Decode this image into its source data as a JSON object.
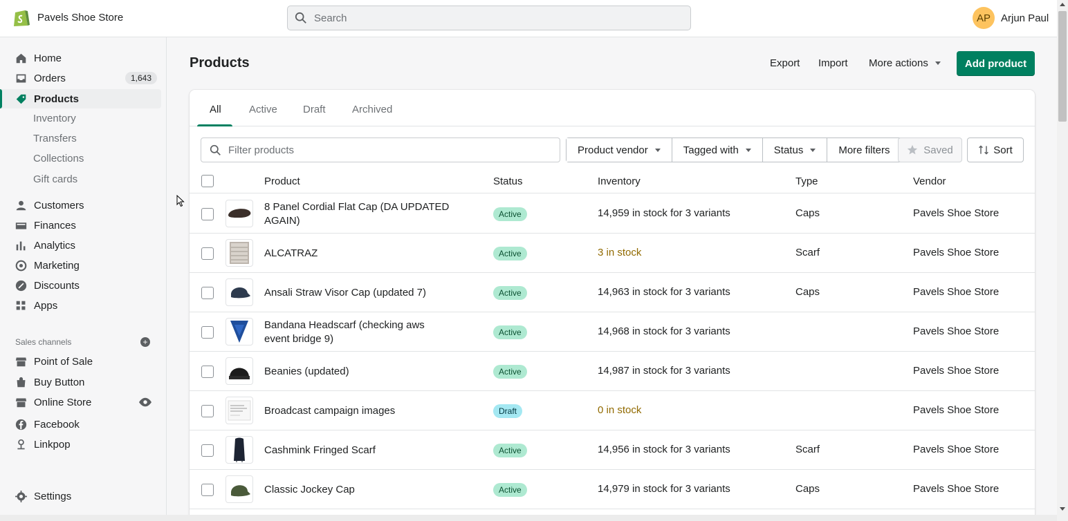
{
  "store": {
    "name": "Pavels Shoe Store"
  },
  "search": {
    "placeholder": "Search"
  },
  "user": {
    "initials": "AP",
    "name": "Arjun Paul"
  },
  "sidebar": {
    "home": "Home",
    "orders": "Orders",
    "orders_count": "1,643",
    "products": "Products",
    "sub": [
      "Inventory",
      "Transfers",
      "Collections",
      "Gift cards"
    ],
    "customers": "Customers",
    "finances": "Finances",
    "analytics": "Analytics",
    "marketing": "Marketing",
    "discounts": "Discounts",
    "apps": "Apps",
    "sales_channels_label": "Sales channels",
    "channels": [
      "Point of Sale",
      "Buy Button",
      "Online Store",
      "Facebook",
      "Linkpop"
    ],
    "settings": "Settings"
  },
  "header": {
    "title": "Products",
    "export": "Export",
    "import": "Import",
    "more_actions": "More actions",
    "add_product": "Add product"
  },
  "tabs": [
    "All",
    "Active",
    "Draft",
    "Archived"
  ],
  "filters": {
    "placeholder": "Filter products",
    "vendor": "Product vendor",
    "tagged": "Tagged with",
    "status": "Status",
    "more": "More filters",
    "saved": "Saved",
    "sort": "Sort"
  },
  "table": {
    "headers": [
      "Product",
      "Status",
      "Inventory",
      "Type",
      "Vendor"
    ],
    "rows": [
      {
        "name": "8 Panel Cordial Flat Cap (DA UPDATED AGAIN)",
        "status": "Active",
        "inventory": "14,959 in stock for 3 variants",
        "type": "Caps",
        "vendor": "Pavels Shoe Store"
      },
      {
        "name": "ALCATRAZ",
        "status": "Active",
        "inventory": "3 in stock",
        "type": "Scarf",
        "vendor": "Pavels Shoe Store"
      },
      {
        "name": "Ansali Straw Visor Cap (updated 7)",
        "status": "Active",
        "inventory": "14,963 in stock for 3 variants",
        "type": "Caps",
        "vendor": "Pavels Shoe Store"
      },
      {
        "name": "Bandana Headscarf (checking aws event bridge 9)",
        "status": "Active",
        "inventory": "14,968 in stock for 3 variants",
        "type": "",
        "vendor": "Pavels Shoe Store"
      },
      {
        "name": "Beanies (updated)",
        "status": "Active",
        "inventory": "14,987 in stock for 3 variants",
        "type": "",
        "vendor": "Pavels Shoe Store"
      },
      {
        "name": "Broadcast campaign images",
        "status": "Draft",
        "inventory": "0 in stock",
        "type": "",
        "vendor": "Pavels Shoe Store"
      },
      {
        "name": "Cashmink Fringed Scarf",
        "status": "Active",
        "inventory": "14,956 in stock for 3 variants",
        "type": "Scarf",
        "vendor": "Pavels Shoe Store"
      },
      {
        "name": "Classic Jockey Cap",
        "status": "Active",
        "inventory": "14,979 in stock for 3 variants",
        "type": "Caps",
        "vendor": "Pavels Shoe Store"
      }
    ]
  },
  "colors": {
    "primary": "#008060",
    "active_badge": "#aee9d1",
    "draft_badge": "#a4e8f2",
    "low_stock": "#916a00"
  }
}
